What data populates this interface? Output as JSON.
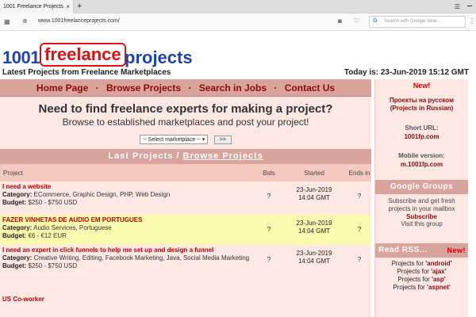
{
  "browser": {
    "tab_title": "1001 Freelance Projects",
    "tab_close": "×",
    "new_tab": "+",
    "url": "www.1001freelanceprojects.com/",
    "search_placeholder": "Search with Google Sear..."
  },
  "header": {
    "logo_1001": "1001",
    "logo_freelance": "freelance",
    "logo_projects": "projects",
    "tagline": "Latest Projects from Freelance Marketplaces",
    "today": "Today is: 23-Jun-2019 15:12 GMT"
  },
  "nav": {
    "items": [
      "Home Page",
      "Browse Projects",
      "Search in Jobs",
      "Contact Us"
    ],
    "sep": "·"
  },
  "promo": {
    "title": "Need to find freelance experts for making a project?",
    "subtitle": "Browse to established marketplaces and post your project!",
    "select_value": "-- Select marketplace --",
    "button": ">>"
  },
  "projects_bar": {
    "left": "Last Projects /",
    "right": "Browse Projects"
  },
  "table": {
    "headers": {
      "project": "Project",
      "bids": "Bids",
      "started": "Started",
      "ends": "Ends in"
    },
    "rows": [
      {
        "title": "I need a website",
        "category_label": "Category:",
        "category": "ECommerce, Graphic Design, PHP, Web Design",
        "budget_label": "Budget:",
        "budget": "$250 - $750 USD",
        "bids": "?",
        "started_date": "23-Jun-2019",
        "started_time": "14:04 GMT",
        "ends": "?"
      },
      {
        "title": "FAZER VINHETAS DE AUDIO EM PORTUGUES",
        "category_label": "Category:",
        "category": "Audio Services, Portuguese",
        "budget_label": "Budget:",
        "budget": "€6 - €12 EUR",
        "bids": "?",
        "started_date": "23-Jun-2019",
        "started_time": "14:04 GMT",
        "ends": "?"
      },
      {
        "title": "I need an expert in click funnels to help me set up and design a funnel",
        "category_label": "Category:",
        "category": "Creative Writing, Editing, Facebook Marketing, Java, Social Media Marketing",
        "budget_label": "Budget:",
        "budget": "$250 - $750 USD",
        "bids": "?",
        "started_date": "23-Jun-2019",
        "started_time": "14:04 GMT",
        "ends": "?"
      },
      {
        "title": "US Co-worker",
        "category_label": "",
        "category": "",
        "budget_label": "",
        "budget": "",
        "bids": "",
        "started_date": "",
        "started_time": "",
        "ends": ""
      }
    ]
  },
  "sidebar": {
    "new_label": "New!",
    "russian_line1": "Проекты на русском",
    "russian_line2": "(Projects in Russian)",
    "short_url_label": "Short URL:",
    "short_url": "1001fp.com",
    "mobile_label": "Mobile version:",
    "mobile_url": "m.1001fp.com",
    "groups_title": "Google Groups",
    "groups_text": "Subscribe and get fresh projects in your mailbox",
    "subscribe": "Subscribe",
    "visit": "Visit this group",
    "rss_title": "Read RSS...",
    "rss_new": "New!",
    "rss_prefix": "Projects for",
    "rss_items": [
      "'android'",
      "'ajax'",
      "'asp'",
      "'aspnet'"
    ]
  },
  "colors": {
    "brand_blue": "#2244aa",
    "brand_red": "#dd1111",
    "nav_bg": "#d9a49b",
    "highlight_row": "#fbfbb0"
  }
}
